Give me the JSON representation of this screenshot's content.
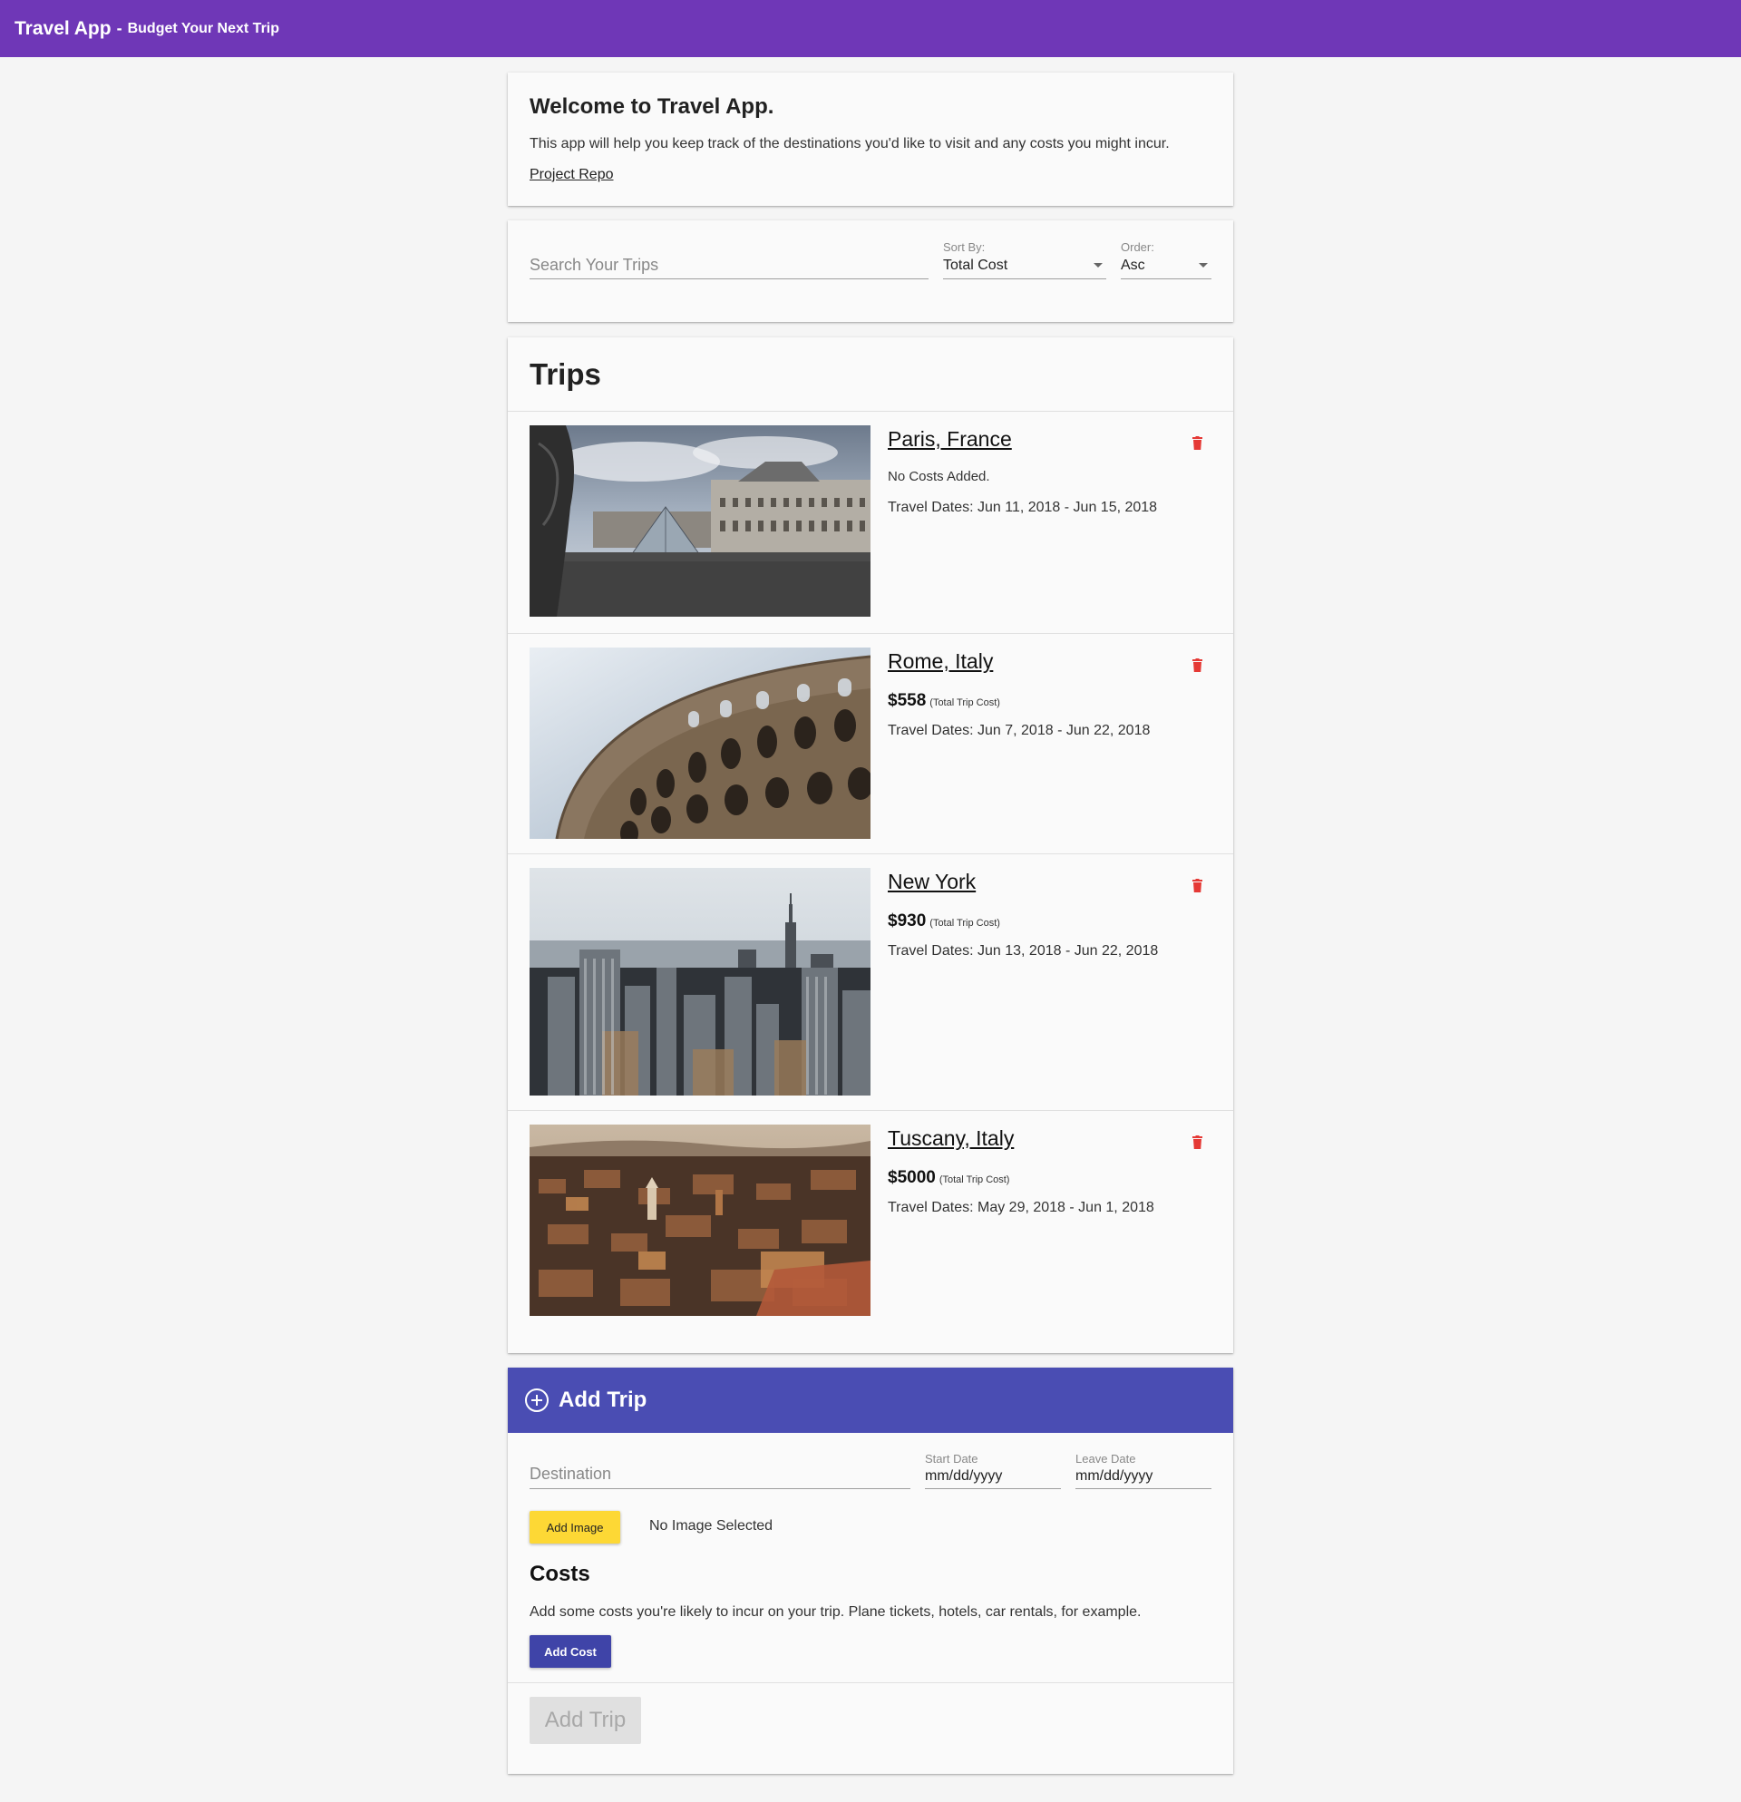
{
  "appbar": {
    "title": "Travel App",
    "separator": "-",
    "subtitle": "Budget Your Next Trip",
    "color": "#6f37b7"
  },
  "welcome": {
    "heading": "Welcome to Travel App.",
    "description": "This app will help you keep track of the destinations you'd like to visit and any costs you might incur.",
    "link_label": "Project Repo"
  },
  "filters": {
    "search_placeholder": "Search Your Trips",
    "sort_label": "Sort By:",
    "sort_value": "Total Cost",
    "order_label": "Order:",
    "order_value": "Asc"
  },
  "trips": {
    "heading": "Trips",
    "items": [
      {
        "name": "Paris, France",
        "cost_text": "No Costs Added.",
        "cost": "",
        "cost_note": "",
        "dates": "Travel Dates: Jun 11, 2018 - Jun 15, 2018",
        "image": "louvre-photo"
      },
      {
        "name": "Rome, Italy",
        "cost_text": "",
        "cost": "$558",
        "cost_note": "(Total Trip Cost)",
        "dates": "Travel Dates: Jun 7, 2018 - Jun 22, 2018",
        "image": "colosseum-photo"
      },
      {
        "name": "New York",
        "cost_text": "",
        "cost": "$930",
        "cost_note": "(Total Trip Cost)",
        "dates": "Travel Dates: Jun 13, 2018 - Jun 22, 2018",
        "image": "new-york-skyline-photo"
      },
      {
        "name": "Tuscany, Italy",
        "cost_text": "",
        "cost": "$5000",
        "cost_note": "(Total Trip Cost)",
        "dates": "Travel Dates: May 29, 2018 - Jun 1, 2018",
        "image": "tuscany-rooftops-photo"
      }
    ]
  },
  "add_trip": {
    "heading": "Add Trip",
    "destination_placeholder": "Destination",
    "start_label": "Start Date",
    "start_value": "mm/dd/yyyy",
    "leave_label": "Leave Date",
    "leave_value": "mm/dd/yyyy",
    "add_image_label": "Add Image",
    "image_status": "No Image Selected",
    "costs_heading": "Costs",
    "costs_description": "Add some costs you're likely to incur on your trip. Plane tickets, hotels, car rentals, for example.",
    "add_cost_label": "Add Cost",
    "submit_label": "Add Trip",
    "header_color": "#4a4db3"
  },
  "colors": {
    "trash": "#e53935",
    "add_image": "#fdd835",
    "add_cost": "#3f44a8"
  }
}
